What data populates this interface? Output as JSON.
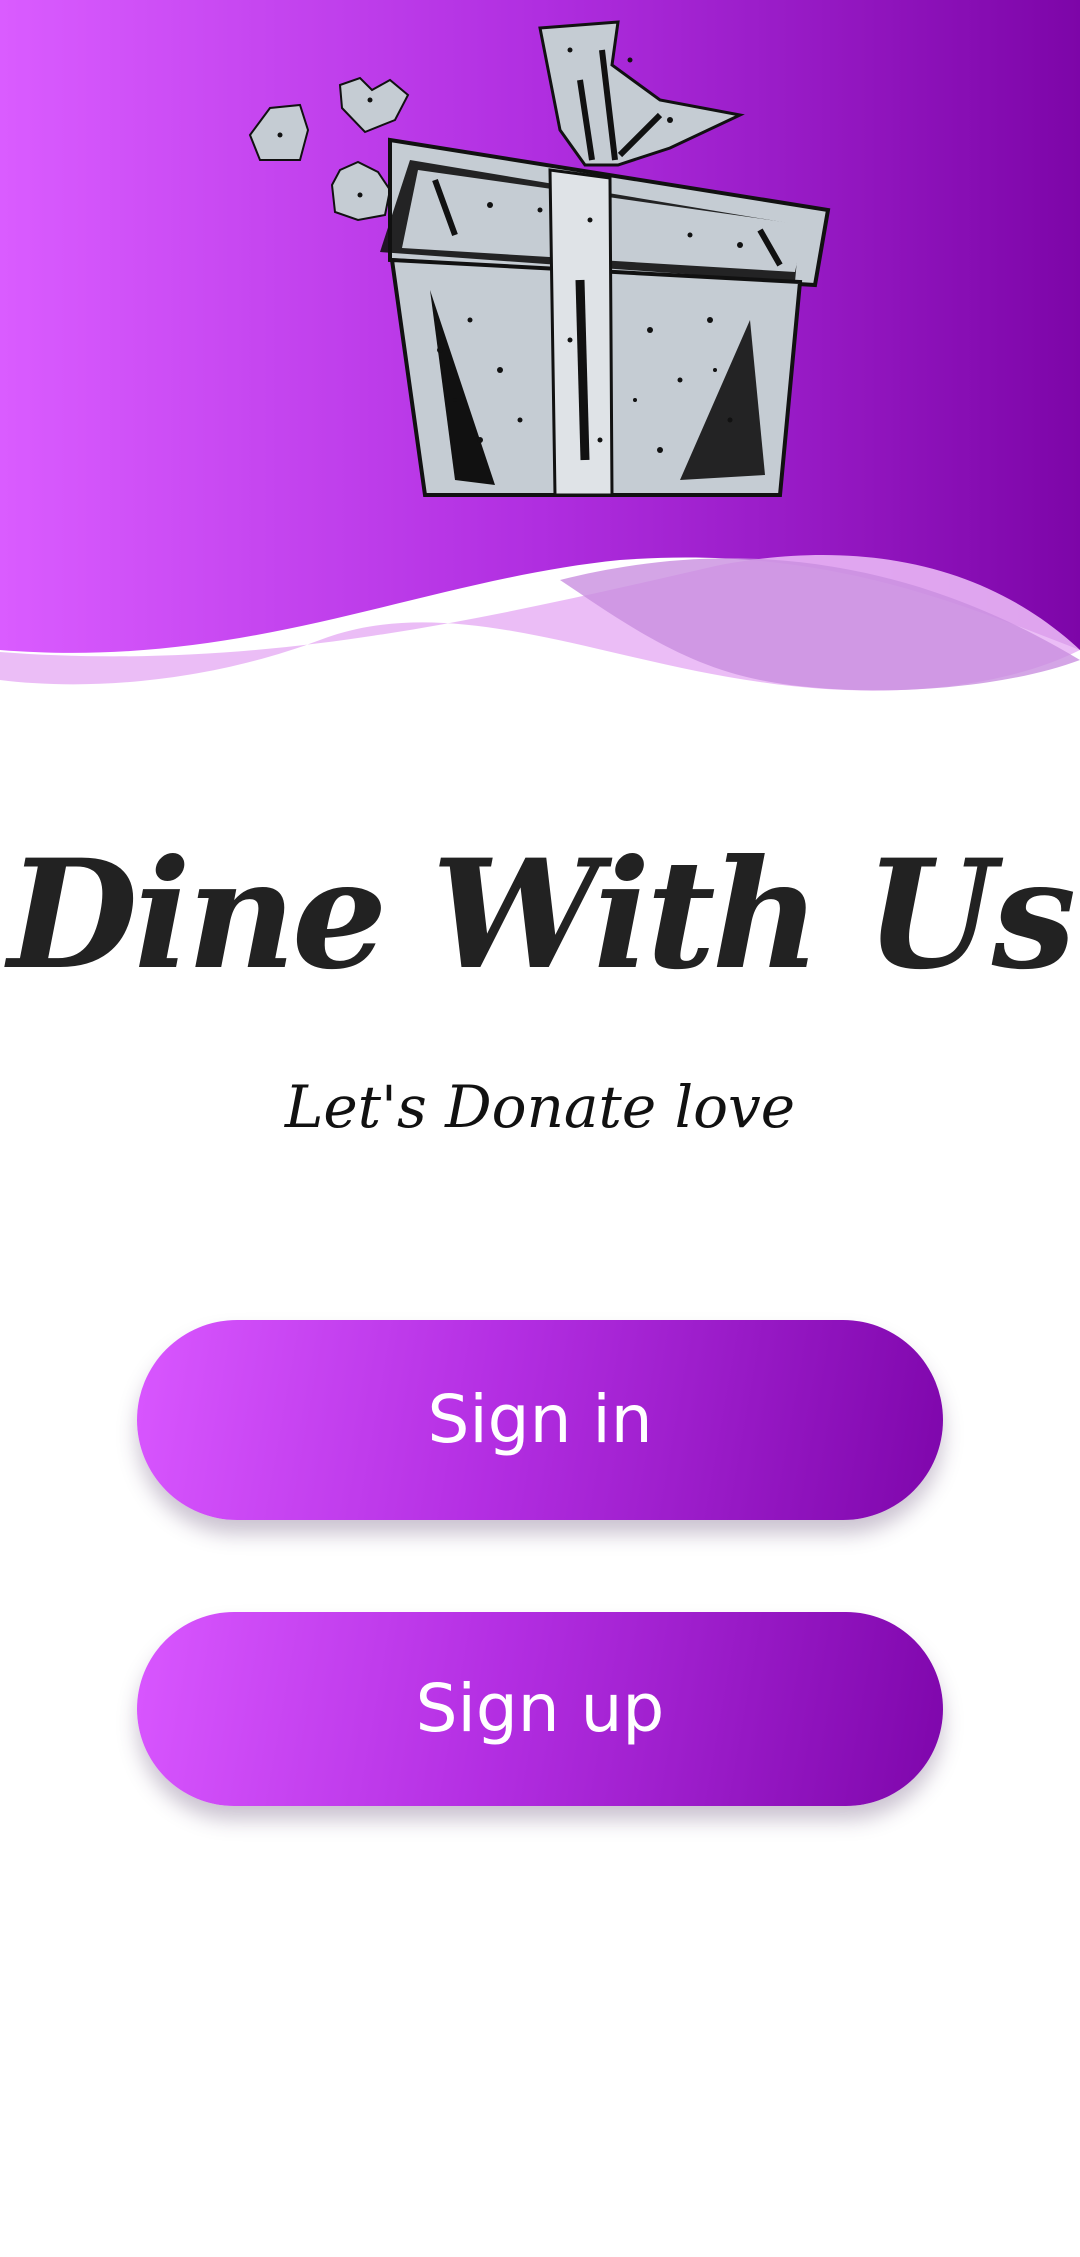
{
  "app": {
    "title": "Dine With Us",
    "tagline": "Let's Donate love"
  },
  "actions": {
    "sign_in_label": "Sign in",
    "sign_up_label": "Sign up"
  },
  "theme": {
    "gradient_start": "#d957ff",
    "gradient_end": "#7e06ab",
    "title_color": "#222222"
  },
  "illustration": {
    "icon": "gift-box-with-hearts-icon"
  }
}
